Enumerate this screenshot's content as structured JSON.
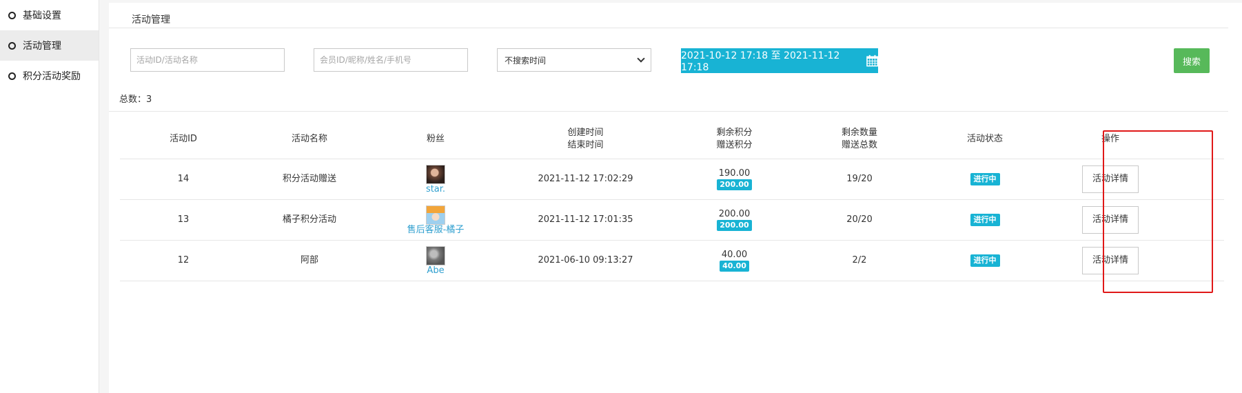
{
  "sidebar": {
    "items": [
      {
        "label": "基础设置",
        "active": false
      },
      {
        "label": "活动管理",
        "active": true
      },
      {
        "label": "积分活动奖励",
        "active": false
      }
    ]
  },
  "header": {
    "title": "活动管理"
  },
  "filters": {
    "activity_placeholder": "活动ID/活动名称",
    "member_placeholder": "会员ID/昵称/姓名/手机号",
    "time_select": "不搜索时间",
    "date_range": "2021-10-12 17:18 至 2021-11-12 17:18",
    "search_label": "搜索"
  },
  "summary": {
    "total": "总数：3"
  },
  "table": {
    "headers": {
      "id": "活动ID",
      "name": "活动名称",
      "fans": "粉丝",
      "time_1": "创建时间",
      "time_2": "结束时间",
      "points_1": "剩余积分",
      "points_2": "赠送积分",
      "count_1": "剩余数量",
      "count_2": "赠送总数",
      "status": "活动状态",
      "action": "操作"
    },
    "rows": [
      {
        "id": "14",
        "name": "积分活动赠送",
        "fan": "star.",
        "created": "2021-11-12 17:02:29",
        "remaining_points": "190.00",
        "gift_points": "200.00",
        "quantity": "19/20",
        "status": "进行中",
        "action": "活动详情"
      },
      {
        "id": "13",
        "name": "橘子积分活动",
        "fan": "售后客服-橘子",
        "created": "2021-11-12 17:01:35",
        "remaining_points": "200.00",
        "gift_points": "200.00",
        "quantity": "20/20",
        "status": "进行中",
        "action": "活动详情"
      },
      {
        "id": "12",
        "name": "阿部",
        "fan": "Abe",
        "created": "2021-06-10 09:13:27",
        "remaining_points": "40.00",
        "gift_points": "40.00",
        "quantity": "2/2",
        "status": "进行中",
        "action": "活动详情"
      }
    ]
  },
  "colors": {
    "accent": "#18b3d4",
    "search": "#57b95a",
    "highlight": "#e01818",
    "link": "#2f9fcf"
  }
}
